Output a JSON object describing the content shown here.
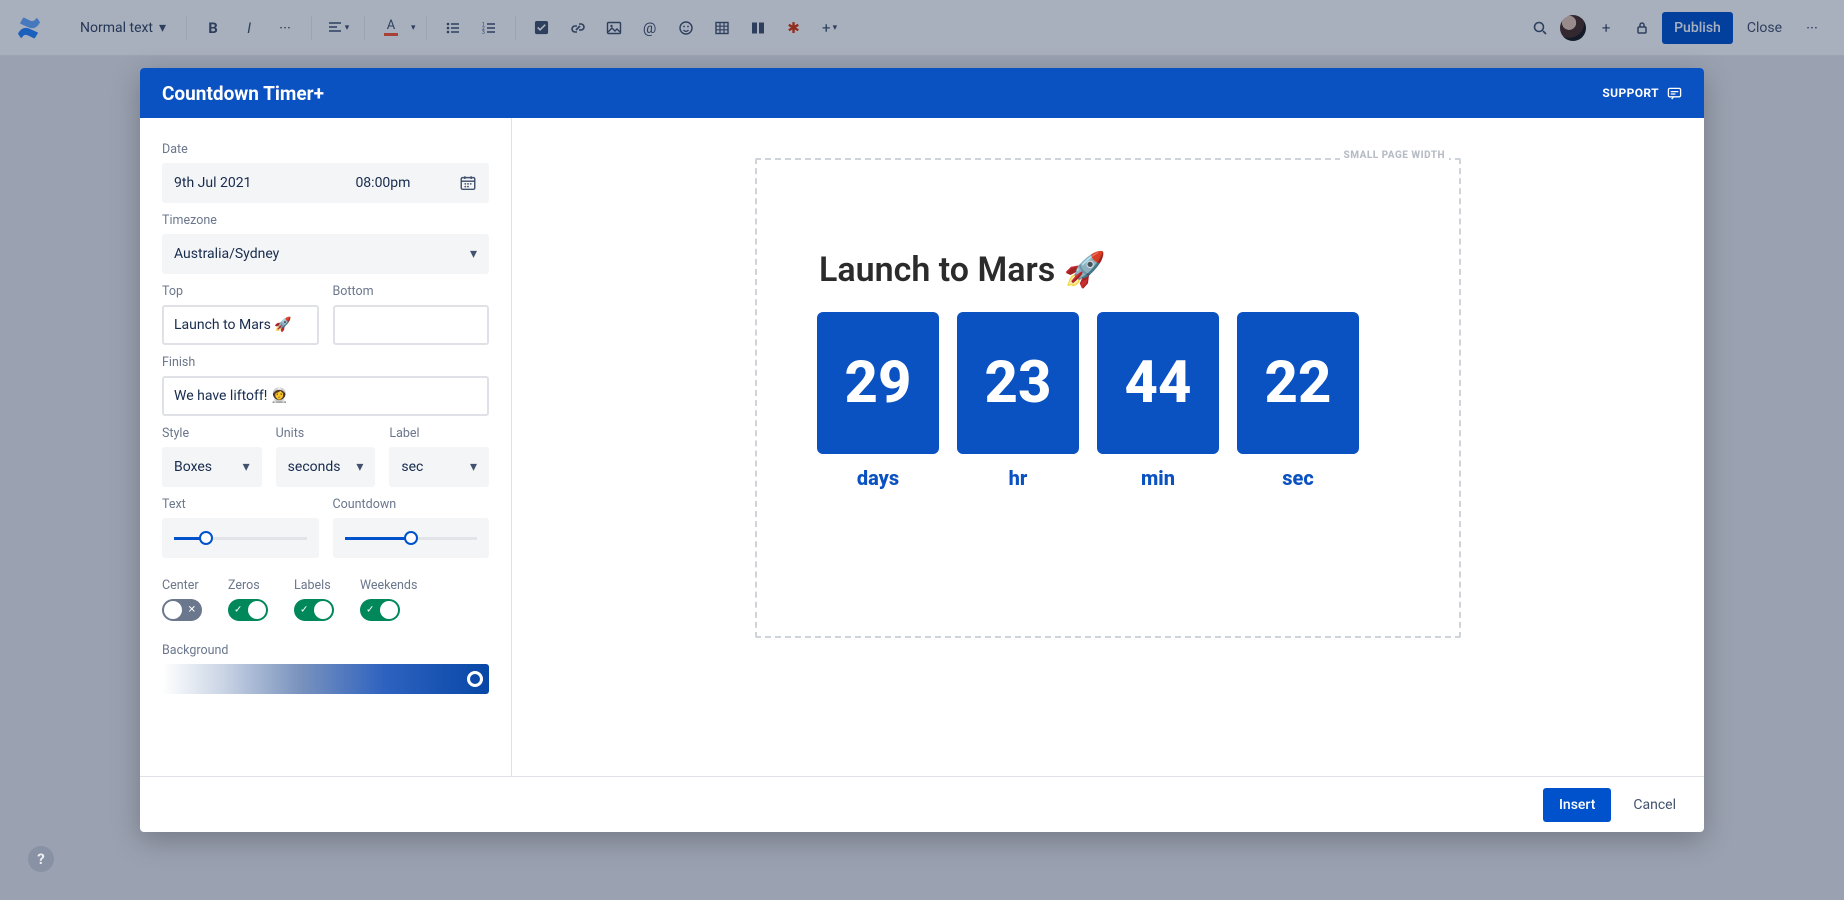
{
  "toolbar": {
    "text_style": "Normal text",
    "publish": "Publish",
    "close": "Close"
  },
  "modal": {
    "title": "Countdown Timer+",
    "support": "SUPPORT",
    "insert": "Insert",
    "cancel": "Cancel"
  },
  "labels": {
    "date": "Date",
    "timezone": "Timezone",
    "top": "Top",
    "bottom": "Bottom",
    "finish": "Finish",
    "style": "Style",
    "units": "Units",
    "label": "Label",
    "text": "Text",
    "countdown": "Countdown",
    "center": "Center",
    "zeros": "Zeros",
    "labels_t": "Labels",
    "weekends": "Weekends",
    "background": "Background"
  },
  "values": {
    "date": "9th Jul 2021",
    "time": "08:00pm",
    "timezone": "Australia/Sydney",
    "top": "Launch to Mars 🚀",
    "bottom": "",
    "finish": "We have liftoff! 👩‍🚀",
    "style": "Boxes",
    "units": "seconds",
    "label": "sec"
  },
  "sliders": {
    "text_pct": 24,
    "countdown_pct": 50
  },
  "toggles": {
    "center": false,
    "zeros": true,
    "labels": true,
    "weekends": true
  },
  "preview": {
    "frame_tag": "SMALL PAGE WIDTH",
    "title": "Launch to Mars 🚀",
    "boxes": [
      {
        "num": "29",
        "unit": "days"
      },
      {
        "num": "23",
        "unit": "hr"
      },
      {
        "num": "44",
        "unit": "min"
      },
      {
        "num": "22",
        "unit": "sec"
      }
    ]
  }
}
